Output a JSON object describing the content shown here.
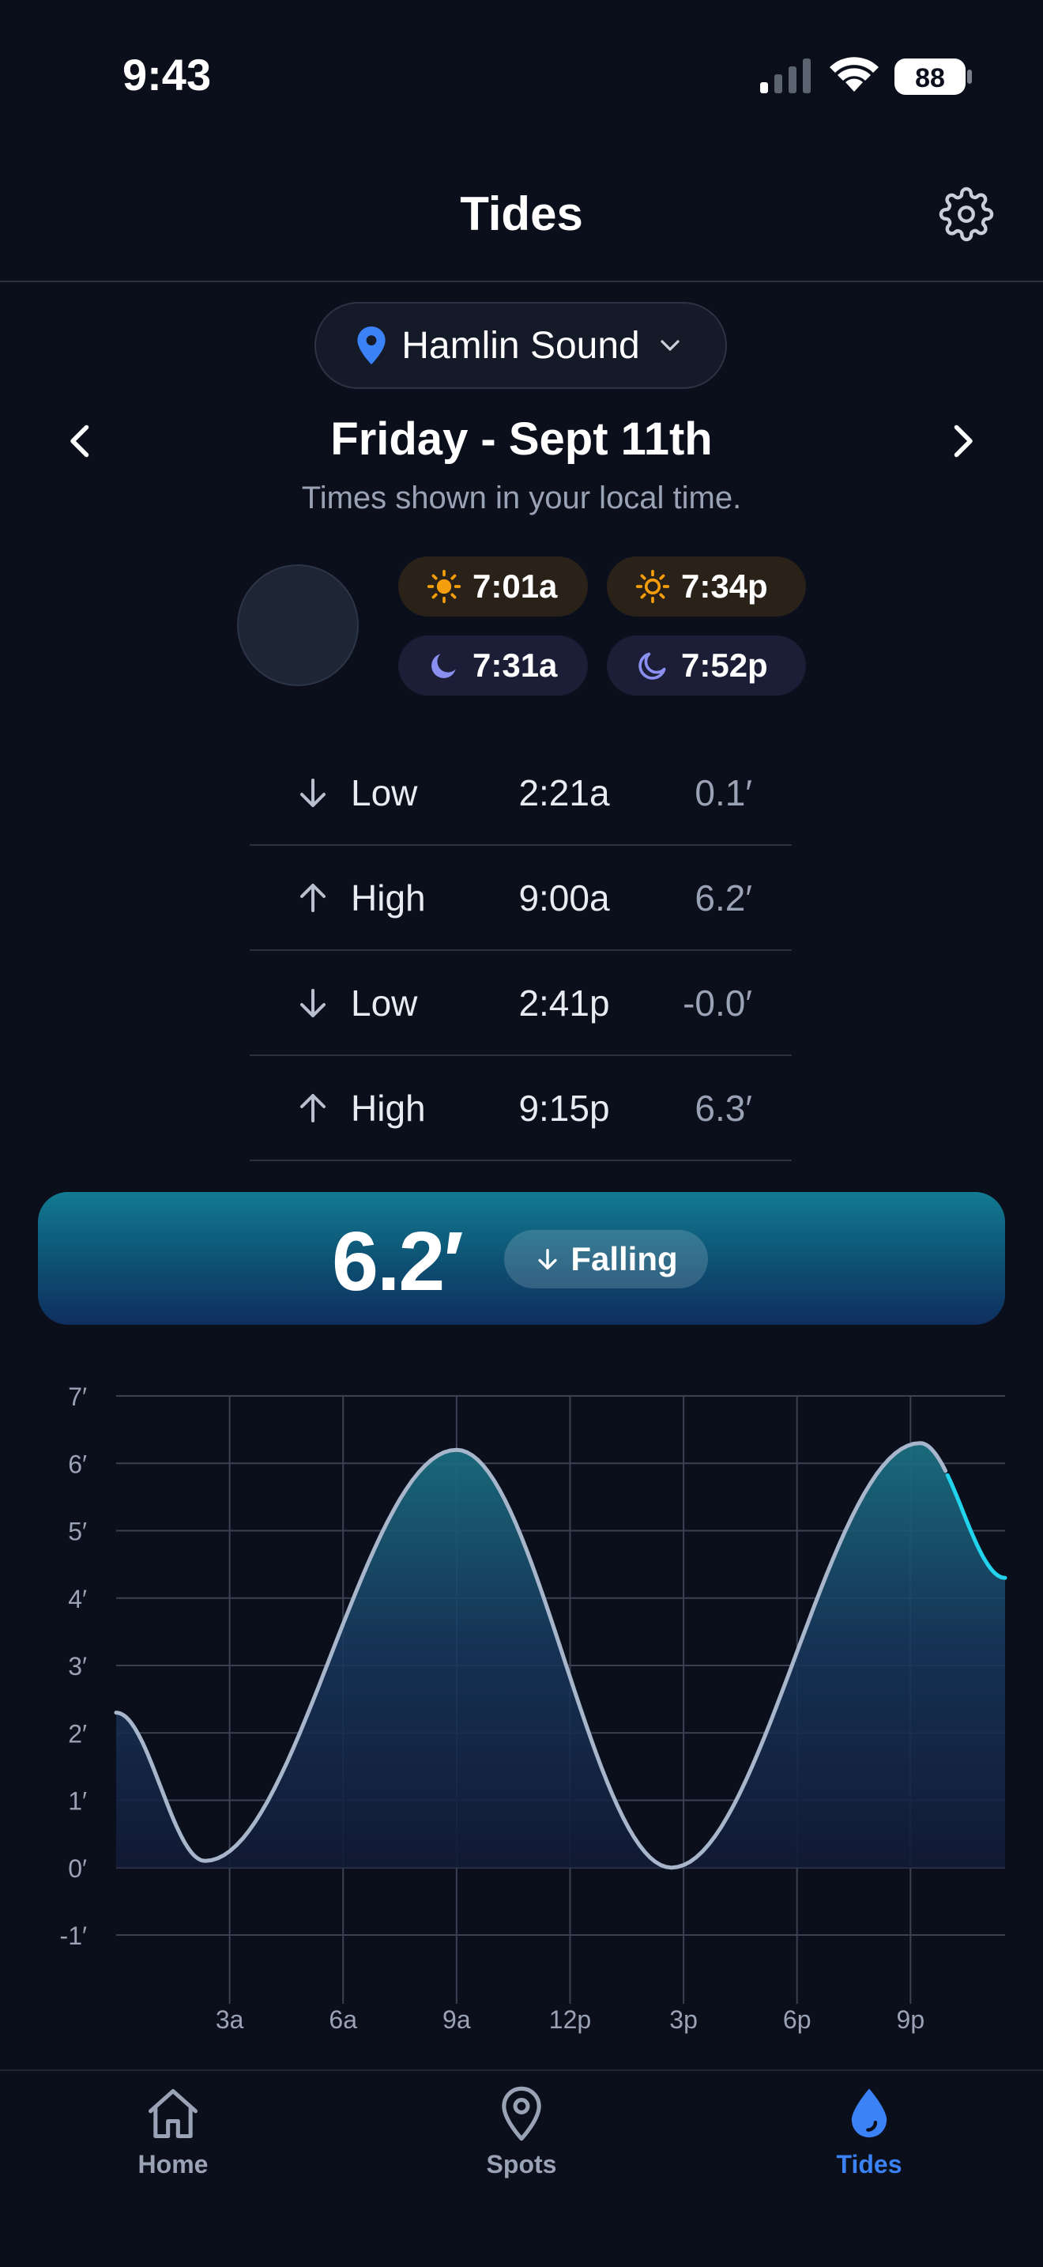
{
  "status_bar": {
    "time": "9:43",
    "battery": "88"
  },
  "header": {
    "title": "Tides"
  },
  "location": {
    "name": "Hamlin Sound"
  },
  "date": {
    "label": "Friday - Sept 11th",
    "subtitle": "Times shown in your local time."
  },
  "sun_moon": {
    "sunrise": "7:01a",
    "sunset": "7:34p",
    "moonrise": "7:31a",
    "moonset": "7:52p"
  },
  "tides": [
    {
      "direction": "down",
      "type": "Low",
      "time": "2:21a",
      "height": "0.1′"
    },
    {
      "direction": "up",
      "type": "High",
      "time": "9:00a",
      "height": "6.2′"
    },
    {
      "direction": "down",
      "type": "Low",
      "time": "2:41p",
      "height": "-0.0′"
    },
    {
      "direction": "up",
      "type": "High",
      "time": "9:15p",
      "height": "6.3′"
    }
  ],
  "current": {
    "height": "6.2′",
    "trend": "Falling"
  },
  "colors": {
    "background": "#0b0f1c",
    "accent_blue": "#3b82f6",
    "sun_orange": "#f59e0b",
    "moon_purple": "#8b8ff0",
    "curve": "#a8b6cc",
    "curve_highlight": "#22d3ee"
  },
  "chart_data": {
    "type": "area",
    "title": "",
    "xlabel": "",
    "ylabel": "",
    "ylim": [
      -1,
      7
    ],
    "y_ticks": [
      "7′",
      "6′",
      "5′",
      "4′",
      "3′",
      "2′",
      "1′",
      "0′",
      "-1′"
    ],
    "x_ticks": [
      "3a",
      "6a",
      "9a",
      "12p",
      "3p",
      "6p",
      "9p"
    ],
    "x_tick_hours": [
      3,
      6,
      9,
      12,
      15,
      18,
      21
    ],
    "xlim_hours": [
      0,
      23.5
    ],
    "grid": true,
    "series": [
      {
        "x_hours": [
          0,
          2.35,
          9.0,
          14.68,
          21.25,
          23.5
        ],
        "y": [
          2.3,
          0.1,
          6.2,
          0.0,
          6.3,
          4.3
        ]
      }
    ],
    "now_hour": 21.95
  },
  "tab_bar": {
    "items": [
      {
        "label": "Home",
        "icon": "house-icon",
        "active": false
      },
      {
        "label": "Spots",
        "icon": "map-pin-icon",
        "active": false
      },
      {
        "label": "Tides",
        "icon": "water-drop-icon",
        "active": true
      }
    ]
  }
}
